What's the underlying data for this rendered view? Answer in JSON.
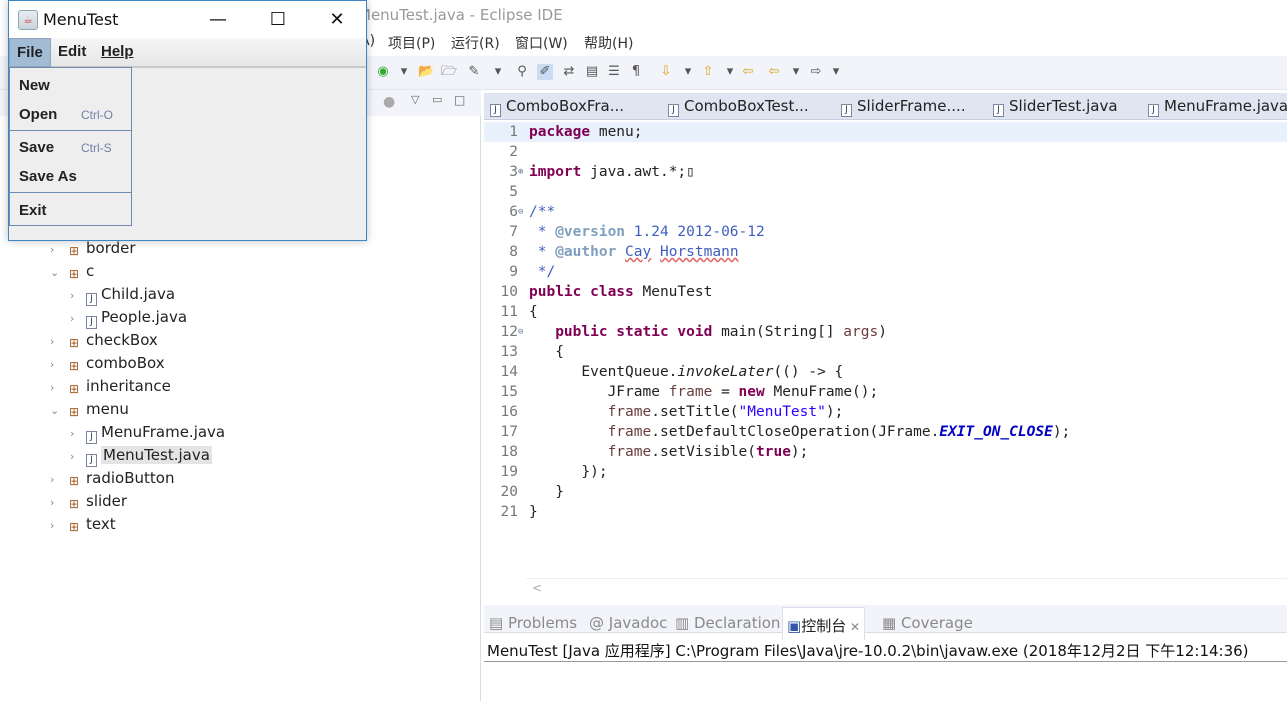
{
  "ide": {
    "title": "MenuTest.java - Eclipse IDE",
    "menu": [
      "A)",
      "项目(P)",
      "运行(R)",
      "窗口(W)",
      "帮助(H)"
    ],
    "toolbar_icons": [
      "run-icon",
      "dropdown-icon",
      "open-project-icon",
      "open-folder-icon",
      "wand-icon",
      "dropdown-icon",
      "pin-icon",
      "highlight-icon",
      "link-icon",
      "outline-icon",
      "block-icon",
      "pilcrow-icon",
      "next-annotation-icon",
      "dropdown-icon",
      "prev-annotation-icon",
      "dropdown-icon",
      "back-edit-icon",
      "back-icon",
      "dropdown-icon",
      "forward-icon",
      "dropdown-icon"
    ]
  },
  "explorer": {
    "items": [
      {
        "label": "border",
        "type": "package",
        "expanded": false,
        "level": 1
      },
      {
        "label": "c",
        "type": "package",
        "expanded": true,
        "level": 1
      },
      {
        "label": "Child.java",
        "type": "file",
        "expanded": false,
        "level": 2
      },
      {
        "label": "People.java",
        "type": "file",
        "expanded": false,
        "level": 2
      },
      {
        "label": "checkBox",
        "type": "package",
        "expanded": false,
        "level": 1
      },
      {
        "label": "comboBox",
        "type": "package",
        "expanded": false,
        "level": 1
      },
      {
        "label": "inheritance",
        "type": "package",
        "expanded": false,
        "level": 1
      },
      {
        "label": "menu",
        "type": "package",
        "expanded": true,
        "level": 1
      },
      {
        "label": "MenuFrame.java",
        "type": "file",
        "expanded": false,
        "level": 2
      },
      {
        "label": "MenuTest.java",
        "type": "file",
        "expanded": false,
        "level": 2,
        "selected": true
      },
      {
        "label": "radioButton",
        "type": "package",
        "expanded": false,
        "level": 1
      },
      {
        "label": "slider",
        "type": "package",
        "expanded": false,
        "level": 1
      },
      {
        "label": "text",
        "type": "package",
        "expanded": false,
        "level": 1
      }
    ]
  },
  "editor": {
    "tabs": [
      "ComboBoxFra...",
      "ComboBoxTest...",
      "SliderFrame....",
      "SliderTest.java",
      "MenuFrame.java"
    ],
    "lines": [
      {
        "n": "1",
        "segs": [
          [
            "package",
            "kw"
          ],
          [
            " menu;",
            ""
          ]
        ]
      },
      {
        "n": "2",
        "segs": []
      },
      {
        "n": "3",
        "fold": "⊕",
        "segs": [
          [
            "import",
            "kw"
          ],
          [
            " java.awt.*;",
            ""
          ],
          [
            "▯",
            ""
          ]
        ]
      },
      {
        "n": "5",
        "segs": []
      },
      {
        "n": "6",
        "fold": "⊖",
        "segs": [
          [
            "/**",
            "cm"
          ]
        ]
      },
      {
        "n": "7",
        "segs": [
          [
            " * ",
            "cm"
          ],
          [
            "@version",
            "cmt"
          ],
          [
            " 1.24 2012-06-12",
            "cm"
          ]
        ]
      },
      {
        "n": "8",
        "segs": [
          [
            " * ",
            "cm"
          ],
          [
            "@author",
            "cmt"
          ],
          [
            " ",
            "cm"
          ],
          [
            "Cay",
            "cm sq"
          ],
          [
            " ",
            "cm"
          ],
          [
            "Horstmann",
            "cm sq"
          ]
        ]
      },
      {
        "n": "9",
        "segs": [
          [
            " */",
            "cm"
          ]
        ]
      },
      {
        "n": "10",
        "segs": [
          [
            "public class",
            "kw"
          ],
          [
            " MenuTest",
            ""
          ]
        ]
      },
      {
        "n": "11",
        "segs": [
          [
            "{",
            ""
          ]
        ]
      },
      {
        "n": "12",
        "fold": "⊖",
        "segs": [
          [
            "   ",
            ""
          ],
          [
            "public static void",
            "kw"
          ],
          [
            " main(String[] ",
            ""
          ],
          [
            "args",
            "par"
          ],
          [
            ")",
            ""
          ]
        ]
      },
      {
        "n": "13",
        "segs": [
          [
            "   {",
            ""
          ]
        ]
      },
      {
        "n": "14",
        "segs": [
          [
            "      EventQueue.",
            ""
          ],
          [
            "invokeLater",
            "it"
          ],
          [
            "(() -> {",
            ""
          ]
        ]
      },
      {
        "n": "15",
        "segs": [
          [
            "         JFrame ",
            ""
          ],
          [
            "frame",
            "par"
          ],
          [
            " = ",
            ""
          ],
          [
            "new",
            "kw"
          ],
          [
            " MenuFrame();",
            ""
          ]
        ]
      },
      {
        "n": "16",
        "segs": [
          [
            "         ",
            ""
          ],
          [
            "frame",
            "par"
          ],
          [
            ".setTitle(",
            ""
          ],
          [
            "\"MenuTest\"",
            "str"
          ],
          [
            ");",
            ""
          ]
        ]
      },
      {
        "n": "17",
        "segs": [
          [
            "         ",
            ""
          ],
          [
            "frame",
            "par"
          ],
          [
            ".setDefaultCloseOperation(JFrame.",
            ""
          ],
          [
            "EXIT_ON_CLOSE",
            "sfld"
          ],
          [
            ");",
            ""
          ]
        ]
      },
      {
        "n": "18",
        "segs": [
          [
            "         ",
            ""
          ],
          [
            "frame",
            "par"
          ],
          [
            ".setVisible(",
            ""
          ],
          [
            "true",
            "kw"
          ],
          [
            ");",
            ""
          ]
        ]
      },
      {
        "n": "19",
        "segs": [
          [
            "      });",
            ""
          ]
        ]
      },
      {
        "n": "20",
        "segs": [
          [
            "   }",
            ""
          ]
        ]
      },
      {
        "n": "21",
        "segs": [
          [
            "}",
            ""
          ]
        ]
      }
    ]
  },
  "bottom": {
    "tabs": [
      "Problems",
      "Javadoc",
      "Declaration",
      "控制台",
      "Coverage"
    ],
    "active_tab": "控制台",
    "console_line": "MenuTest [Java 应用程序] C:\\Program Files\\Java\\jre-10.0.2\\bin\\javaw.exe  (2018年12月2日 下午12:14:36)"
  },
  "swing": {
    "title": "MenuTest",
    "menus": [
      "File",
      "Edit",
      "Help"
    ],
    "open_menu": "File",
    "file_menu": [
      {
        "label": "New",
        "accel": ""
      },
      {
        "label": "Open",
        "accel": "Ctrl-O"
      },
      {
        "label": "Save",
        "accel": "Ctrl-S"
      },
      {
        "label": "Save As",
        "accel": ""
      },
      {
        "label": "Exit",
        "accel": ""
      }
    ]
  }
}
